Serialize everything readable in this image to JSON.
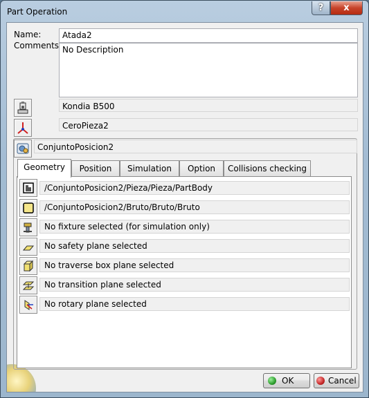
{
  "window": {
    "title": "Part Operation"
  },
  "titlebar": {
    "help_label": "?",
    "close_label": "x"
  },
  "form": {
    "name_label": "Name:",
    "name_value": "Atada2",
    "comments_label": "Comments:",
    "comments_value": "No Description",
    "machine_value": "Kondia B500",
    "reference_value": "CeroPieza2",
    "product_value": "ConjuntoPosicion2"
  },
  "tabs": [
    "Geometry",
    "Position",
    "Simulation",
    "Option",
    "Collisions checking"
  ],
  "geometry_rows": [
    "/ConjuntoPosicion2/Pieza/Pieza/PartBody",
    "/ConjuntoPosicion2/Bruto/Bruto/Bruto",
    "No fixture selected (for simulation only)",
    "No safety plane selected",
    "No traverse box plane selected",
    "No transition plane selected",
    "No rotary plane selected"
  ],
  "buttons": {
    "ok": "OK",
    "cancel": "Cancel"
  },
  "colors": {
    "ok_dot": "#2e9e2e",
    "cancel_dot": "#c62828",
    "titlebar": "#a9c0d6"
  },
  "icons": [
    "machine-icon",
    "reference-axis-icon",
    "product-icon",
    "part-body-icon",
    "stock-icon",
    "fixture-icon",
    "safety-plane-icon",
    "traverse-box-icon",
    "transition-plane-icon",
    "rotary-plane-icon"
  ]
}
